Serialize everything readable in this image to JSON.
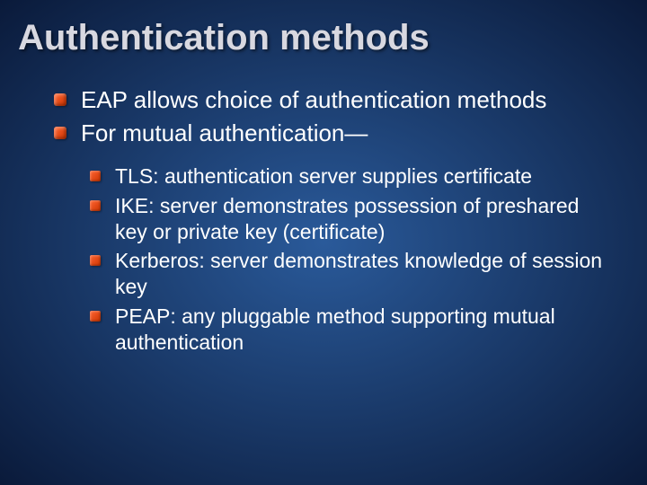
{
  "title": "Authentication methods",
  "bullets": [
    {
      "text": "EAP allows choice of authentication methods"
    },
    {
      "text": "For mutual authentication—"
    }
  ],
  "sub_bullets": [
    {
      "text": "TLS: authentication server supplies certificate"
    },
    {
      "text": "IKE: server demonstrates possession of preshared key or private key (certificate)"
    },
    {
      "text": "Kerberos: server demonstrates knowledge of session key"
    },
    {
      "text": "PEAP: any pluggable method supporting mutual authentication"
    }
  ]
}
